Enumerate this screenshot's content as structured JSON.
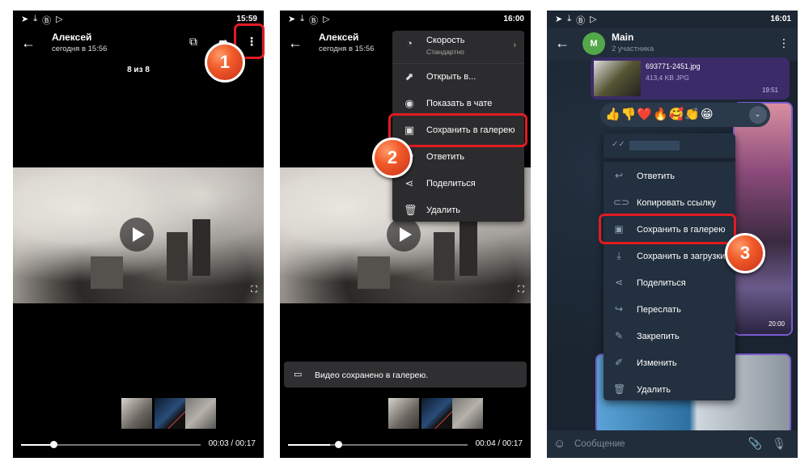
{
  "panel1": {
    "status": {
      "time": "15:59",
      "icons": [
        "telegram-icon",
        "download-icon",
        "b-icon",
        "play-store-icon"
      ]
    },
    "header": {
      "name": "Алексей",
      "subtitle": "сегодня в 15:56"
    },
    "counter": "8 из 8",
    "player": {
      "time": "00:03 / 00:17",
      "progress": 0.18
    },
    "badge": "1"
  },
  "panel2": {
    "status": {
      "time": "16:00"
    },
    "header": {
      "name": "Алексей",
      "subtitle": "сегодня в 15:56"
    },
    "menu": {
      "speed_label": "Скорость",
      "speed_value": "Стандартно",
      "items": [
        "Открыть в...",
        "Показать в чате",
        "Сохранить в галерею",
        "Ответить",
        "Поделиться",
        "Удалить"
      ]
    },
    "toast": "Видео сохранено в галерею.",
    "player": {
      "time": "00:04 / 00:17",
      "progress": 0.23
    },
    "badge": "2"
  },
  "panel3": {
    "status": {
      "time": "16:01"
    },
    "header": {
      "avatar_letter": "M",
      "title": "Main",
      "subtitle": "2 участника"
    },
    "file": {
      "name": "693771-2451.jpg",
      "size": "413,4 KB JPG",
      "time": "19:51"
    },
    "photo_time": "20:00",
    "reactions": "👍👎❤️🔥🥰👏😁",
    "menu": {
      "items": [
        "Ответить",
        "Копировать ссылку",
        "Сохранить в галерею",
        "Сохранить в загрузки",
        "Поделиться",
        "Переслать",
        "Закрепить",
        "Изменить",
        "Удалить"
      ]
    },
    "input_placeholder": "Сообщение",
    "badge": "3"
  },
  "colors": {
    "highlight": "#e11b22",
    "badge": "#f05a28",
    "telegram_bg": "#1c2733",
    "bubble": "#3b2b69"
  }
}
